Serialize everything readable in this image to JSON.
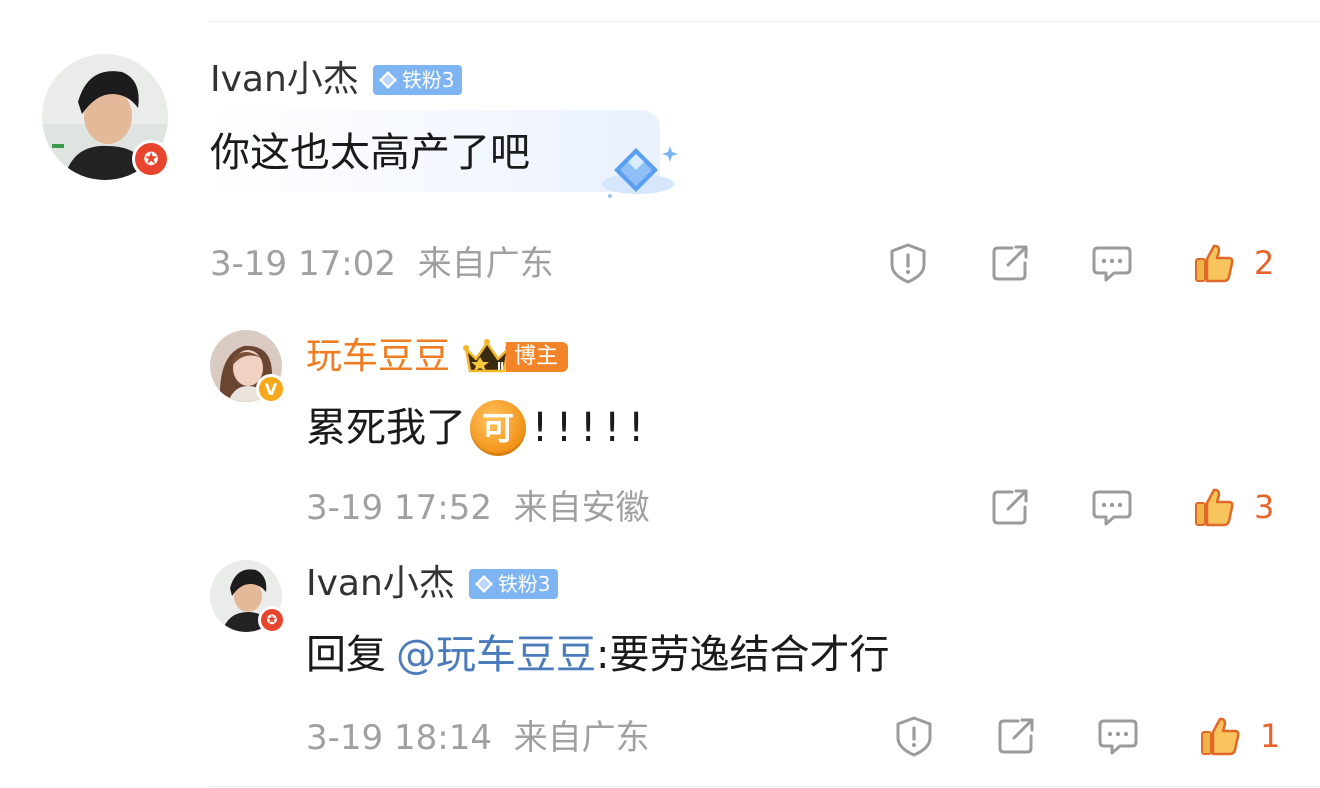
{
  "comments": [
    {
      "username": "Ivan小杰",
      "badge": "铁粉3",
      "text": "你这也太高产了吧",
      "time": "3-19 17:02",
      "location": "来自广东",
      "likes": "2"
    },
    {
      "username": "玩车豆豆",
      "badge": "博主",
      "crown_level": "Ⅱ",
      "verified_mark": "V",
      "text_before": "累死我了",
      "emoji": "可",
      "text_after": "!!!!!",
      "time": "3-19 17:52",
      "location": "来自安徽",
      "likes": "3"
    },
    {
      "username": "Ivan小杰",
      "badge": "铁粉3",
      "reply_prefix": "回复",
      "mention": "@玩车豆豆",
      "text": ":要劳逸结合才行",
      "time": "3-19 18:14",
      "location": "来自广东",
      "likes": "1"
    }
  ],
  "colors": {
    "orange_name": "#f07d22",
    "like": "#e8642a",
    "mention": "#4a7bbb",
    "fan_badge": "#7fb4f3",
    "meta_gray": "#a0a0a0"
  }
}
